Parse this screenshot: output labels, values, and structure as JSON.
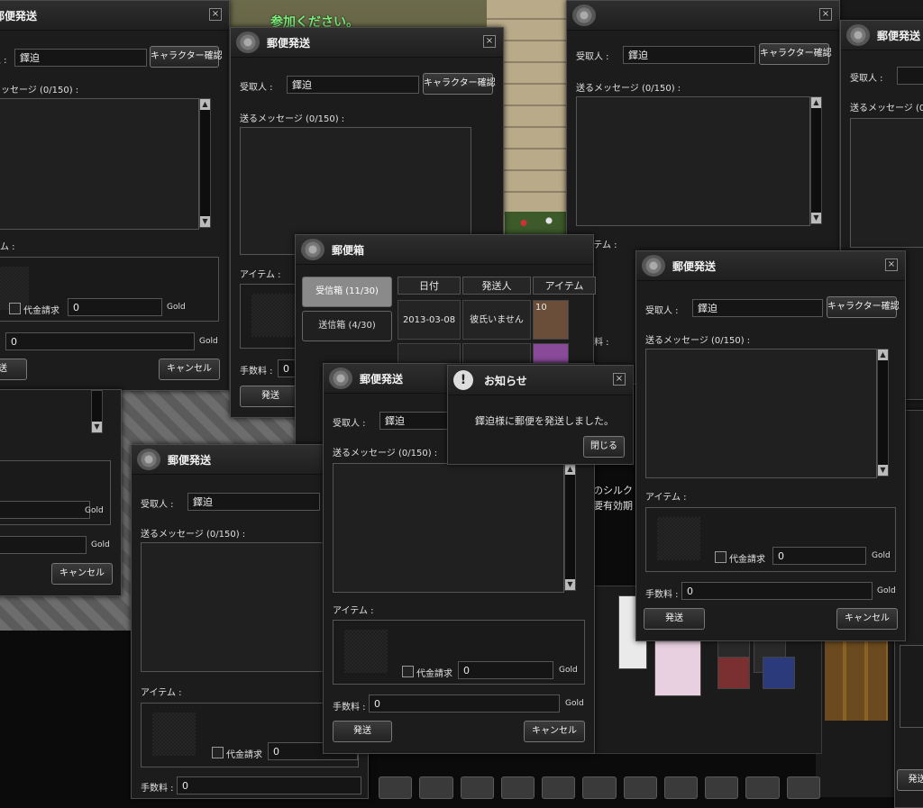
{
  "banner": "参加ください。",
  "send_form": {
    "title": "郵便発送",
    "recipient_label": "受取人 :",
    "recipient_value": "鐸迫",
    "char_check_label": "キャラクター確認",
    "message_label": "送るメッセージ (0/150) :",
    "item_label": "アイテム :",
    "cod_label": "代金請求",
    "cod_value": "0",
    "gold_label": "Gold",
    "fee_label": "手数料 :",
    "fee_value": "0",
    "send_label": "発送",
    "cancel_label": "キャンセル",
    "close_glyph": "×",
    "scroll_up": "▲",
    "scroll_down": "▼"
  },
  "mailbox": {
    "title": "郵便箱",
    "tab_inbox": "受信箱 (11/30)",
    "tab_outbox": "送信箱 (4/30)",
    "columns": [
      "日付",
      "発送人",
      "アイテム"
    ],
    "rows": [
      {
        "date": "2013-03-08",
        "sender": "彼氏いません",
        "item_count": "10"
      }
    ],
    "partial_texts": [
      "期",
      "のシルク",
      "要有効期"
    ]
  },
  "notice": {
    "title": "お知らせ",
    "message": "鐸迫様に郵便を発送しました。",
    "close_label": "閉じる",
    "icon": "exclamation-icon"
  },
  "colors": {
    "banner_green": "#7cf07c",
    "window_bg": "#1c1c1c",
    "border": "#4a4a4a"
  }
}
